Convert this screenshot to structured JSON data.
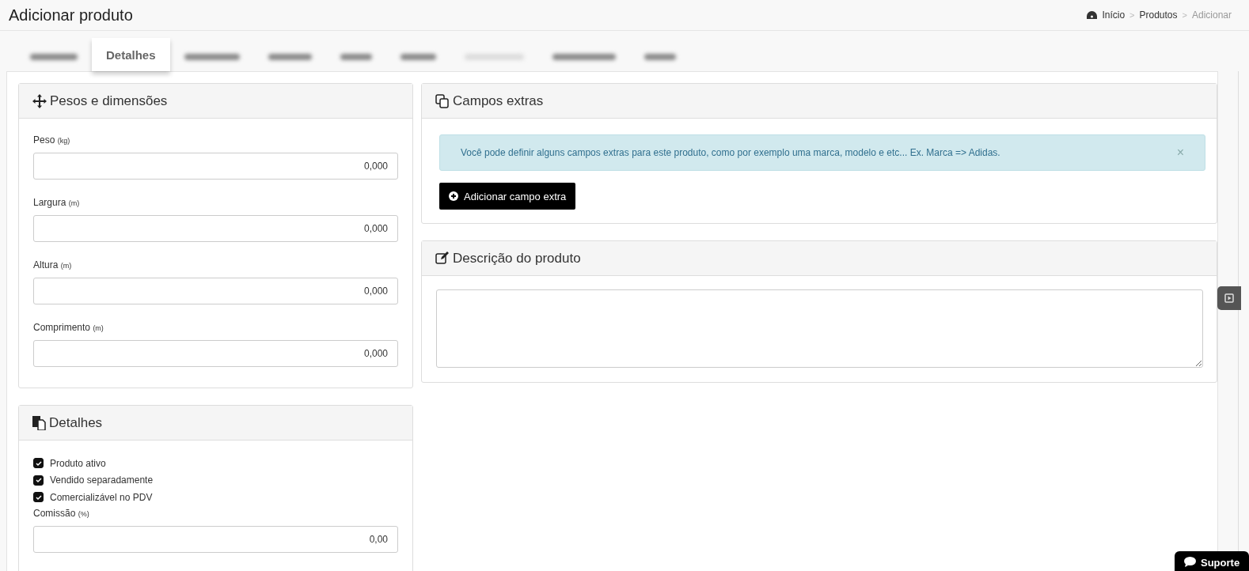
{
  "page_title": "Adicionar produto",
  "breadcrumb": [
    {
      "label": "Início",
      "current": false,
      "separator": ">"
    },
    {
      "label": "Produtos",
      "current": false,
      "separator": ">"
    },
    {
      "label": "Adicionar",
      "current": true
    }
  ],
  "tabs": [
    {
      "selected": false,
      "disabled": false
    },
    {
      "label": "Detalhes",
      "selected": true,
      "disabled": false
    },
    {
      "selected": false,
      "disabled": false
    },
    {
      "selected": false,
      "disabled": false
    },
    {
      "selected": false,
      "disabled": false
    },
    {
      "selected": false,
      "disabled": false
    },
    {
      "selected": false,
      "disabled": true
    },
    {
      "selected": false,
      "disabled": false
    },
    {
      "selected": false,
      "disabled": false
    }
  ],
  "weights_panel": {
    "title": "Pesos e dimensões",
    "fields": [
      {
        "label": "Peso",
        "unit": "(kg)",
        "value": "0,000"
      },
      {
        "label": "Largura",
        "unit": "(m)",
        "value": "0,000"
      },
      {
        "label": "Altura",
        "unit": "(m)",
        "value": "0,000"
      },
      {
        "label": "Comprimento",
        "unit": "(m)",
        "value": "0,000"
      }
    ]
  },
  "details_panel": {
    "title": "Detalhes",
    "checkboxes": [
      {
        "label": "Produto ativo",
        "checked": true
      },
      {
        "label": "Vendido separadamente",
        "checked": true
      },
      {
        "label": "Comercializável no PDV",
        "checked": true
      }
    ],
    "commission": {
      "label": "Comissão",
      "unit": "(%)",
      "value": "0,00"
    }
  },
  "extra_fields_panel": {
    "title": "Campos extras",
    "alert": "Você pode definir alguns campos extras para este produto, como por exemplo uma marca, modelo e etc... Ex. Marca => Adidas.",
    "close_symbol": "×",
    "add_button": "Adicionar campo extra"
  },
  "description_panel": {
    "title": "Descrição do produto"
  },
  "support_button": "Suporte"
}
